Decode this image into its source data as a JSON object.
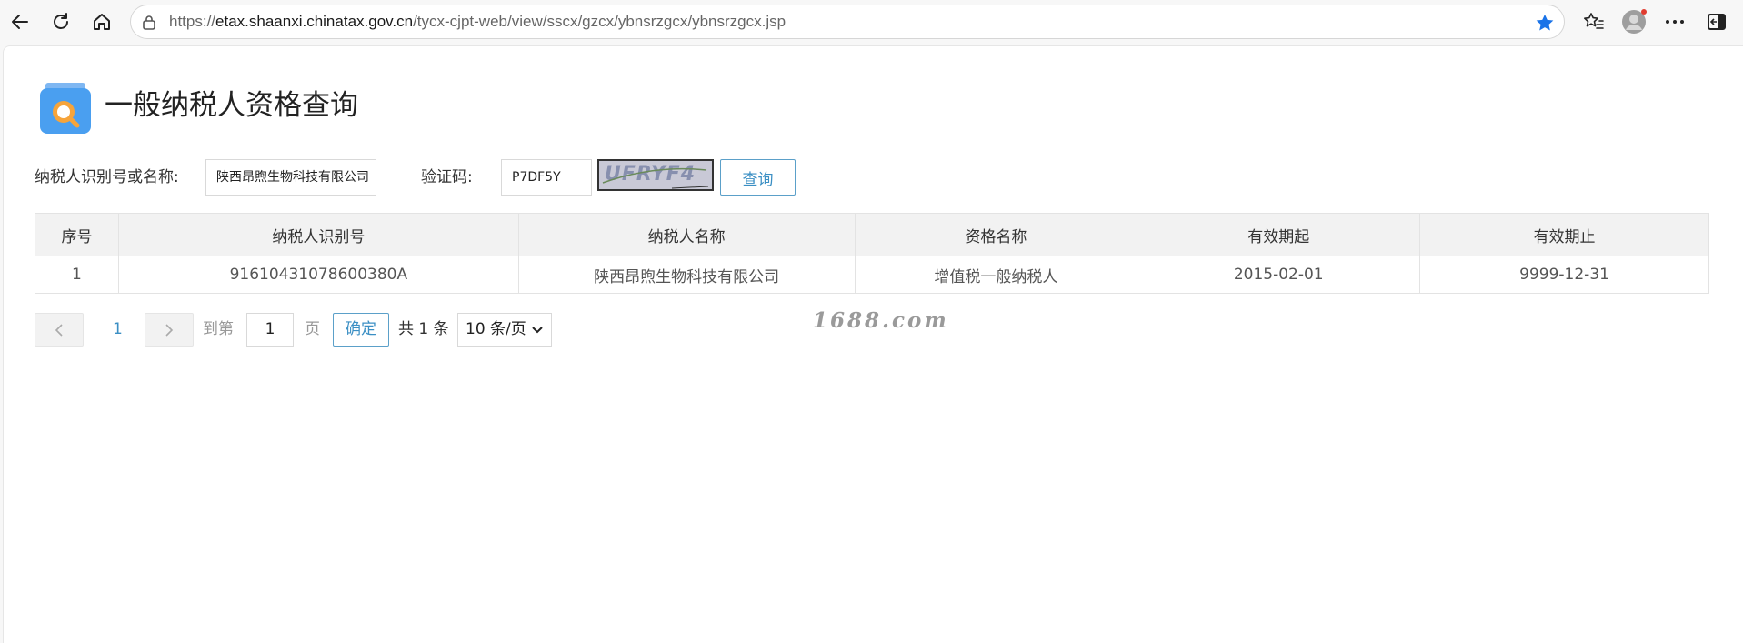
{
  "browser": {
    "url_prefix": "https://",
    "url_host": "etax.shaanxi.chinatax.gov.cn",
    "url_path": "/tycx-cjpt-web/view/sscx/gzcx/ybnsrzgcx/ybnsrzgcx.jsp",
    "accent_color": "#1a73e8"
  },
  "page": {
    "title": "一般纳税人资格查询"
  },
  "form": {
    "taxpayer_label": "纳税人识别号或名称:",
    "taxpayer_value": "陕西昂煦生物科技有限公司",
    "captcha_label": "验证码:",
    "captcha_value": "P7DF5Y",
    "captcha_image_text": "UFRYF4",
    "query_button": "查询"
  },
  "table": {
    "headers": [
      "序号",
      "纳税人识别号",
      "纳税人名称",
      "资格名称",
      "有效期起",
      "有效期止"
    ],
    "rows": [
      [
        "1",
        "91610431078600380A",
        "陕西昂煦生物科技有限公司",
        "增值税一般纳税人",
        "2015-02-01",
        "9999-12-31"
      ]
    ]
  },
  "pager": {
    "current_page": "1",
    "goto_label": "到第",
    "goto_value": "1",
    "page_unit": "页",
    "confirm_button": "确定",
    "total_text": "共 1 条",
    "page_size": "10 条/页"
  },
  "watermark": "1688.com"
}
